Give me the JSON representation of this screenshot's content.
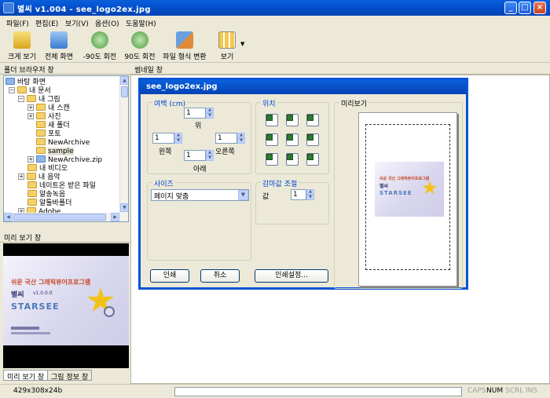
{
  "window": {
    "title": "별씨 v1.004 - see_logo2ex.jpg"
  },
  "menu": [
    "파일(F)",
    "편집(E)",
    "보기(V)",
    "옵션(O)",
    "도움말(H)"
  ],
  "toolbar": [
    {
      "label": "크게 보기",
      "icon": "zoom-icon"
    },
    {
      "label": "전체 화면",
      "icon": "fullscreen-icon"
    },
    {
      "label": "-90도 회전",
      "icon": "rotate-left-icon"
    },
    {
      "label": "90도 회전",
      "icon": "rotate-right-icon"
    },
    {
      "label": "파일 형식 변환",
      "icon": "convert-icon"
    },
    {
      "label": "보기",
      "icon": "view-icon"
    }
  ],
  "folder_panel": {
    "title": "폴더 브라우저 창"
  },
  "tree": [
    {
      "label": "바탕 화면"
    },
    {
      "label": "내 문서"
    },
    {
      "label": "내 그림"
    },
    {
      "label": "내 스캔"
    },
    {
      "label": "사진"
    },
    {
      "label": "새 폴더"
    },
    {
      "label": "포토"
    },
    {
      "label": "NewArchive"
    },
    {
      "label": "sample"
    },
    {
      "label": "NewArchive.zip"
    },
    {
      "label": "내 비디오"
    },
    {
      "label": "내 음악"
    },
    {
      "label": "네이트온 받은 파일"
    },
    {
      "label": "알송녹음"
    },
    {
      "label": "알툴바폴더"
    },
    {
      "label": "Adobe"
    }
  ],
  "preview_panel": {
    "title": "미리 보기 창",
    "banner_line1": "쉬운 국산 그래픽뷰어프로그램",
    "banner_line2": "별씨",
    "banner_version": "v1.0.0.0",
    "banner_brand": "STARSEE"
  },
  "bottom_tabs": [
    "미리 보기 창",
    "그림 정보 창"
  ],
  "thumbnail_panel": {
    "title": "썸네일 창"
  },
  "dialog": {
    "title": "see_logo2ex.jpg",
    "margin": {
      "label": "여백 (cm)",
      "top_label": "위",
      "top_value": "1",
      "left_label": "왼쪽",
      "left_value": "1",
      "right_label": "오른쪽",
      "right_value": "1",
      "bottom_label": "아래",
      "bottom_value": "1"
    },
    "position_label": "위치",
    "preview_label": "미리보기",
    "size": {
      "label": "사이즈",
      "selected": "페이지 맞춤"
    },
    "gamma": {
      "label": "감마값 조절",
      "value_label": "값",
      "value": "1"
    },
    "buttons": {
      "print": "인쇄",
      "cancel": "취소",
      "setup": "인쇄설정..."
    }
  },
  "status": {
    "dims": "429x308x24b",
    "caps": "CAPS",
    "num": "NUM",
    "scrl": "SCRL",
    "ins": "INS"
  }
}
